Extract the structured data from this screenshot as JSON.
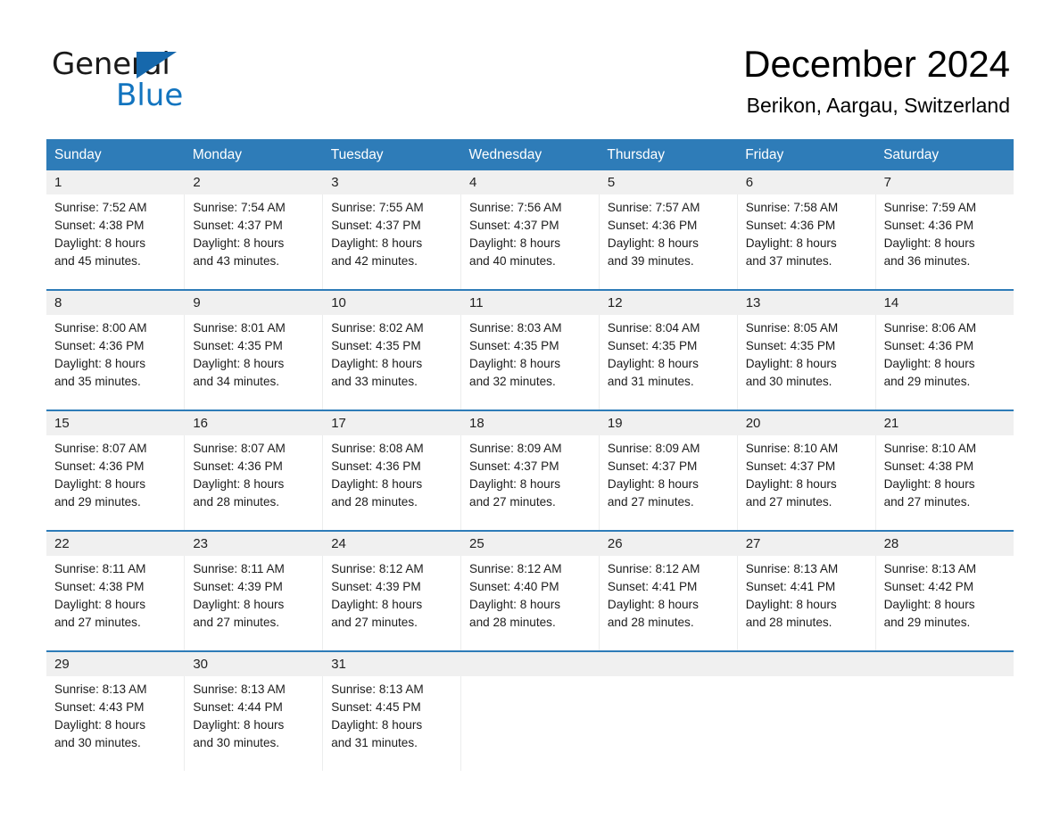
{
  "brand": {
    "word_one": "General",
    "word_two": "Blue",
    "triangle_icon": "triangle-icon",
    "accent_blue": "#1274bf",
    "triangle_color": "#1668ac"
  },
  "header": {
    "title": "December 2024",
    "location": "Berikon, Aargau, Switzerland"
  },
  "colors": {
    "header_row_bg": "#2e7cb8",
    "day_number_bg": "#f0f0f0",
    "divider_blue": "#2e7cb8",
    "text": "#1c1c1c"
  },
  "calendar": {
    "weekdays": [
      "Sunday",
      "Monday",
      "Tuesday",
      "Wednesday",
      "Thursday",
      "Friday",
      "Saturday"
    ],
    "weeks": [
      {
        "days": [
          {
            "num": "1",
            "sunrise": "Sunrise: 7:52 AM",
            "sunset": "Sunset: 4:38 PM",
            "daylight_1": "Daylight: 8 hours",
            "daylight_2": "and 45 minutes."
          },
          {
            "num": "2",
            "sunrise": "Sunrise: 7:54 AM",
            "sunset": "Sunset: 4:37 PM",
            "daylight_1": "Daylight: 8 hours",
            "daylight_2": "and 43 minutes."
          },
          {
            "num": "3",
            "sunrise": "Sunrise: 7:55 AM",
            "sunset": "Sunset: 4:37 PM",
            "daylight_1": "Daylight: 8 hours",
            "daylight_2": "and 42 minutes."
          },
          {
            "num": "4",
            "sunrise": "Sunrise: 7:56 AM",
            "sunset": "Sunset: 4:37 PM",
            "daylight_1": "Daylight: 8 hours",
            "daylight_2": "and 40 minutes."
          },
          {
            "num": "5",
            "sunrise": "Sunrise: 7:57 AM",
            "sunset": "Sunset: 4:36 PM",
            "daylight_1": "Daylight: 8 hours",
            "daylight_2": "and 39 minutes."
          },
          {
            "num": "6",
            "sunrise": "Sunrise: 7:58 AM",
            "sunset": "Sunset: 4:36 PM",
            "daylight_1": "Daylight: 8 hours",
            "daylight_2": "and 37 minutes."
          },
          {
            "num": "7",
            "sunrise": "Sunrise: 7:59 AM",
            "sunset": "Sunset: 4:36 PM",
            "daylight_1": "Daylight: 8 hours",
            "daylight_2": "and 36 minutes."
          }
        ]
      },
      {
        "days": [
          {
            "num": "8",
            "sunrise": "Sunrise: 8:00 AM",
            "sunset": "Sunset: 4:36 PM",
            "daylight_1": "Daylight: 8 hours",
            "daylight_2": "and 35 minutes."
          },
          {
            "num": "9",
            "sunrise": "Sunrise: 8:01 AM",
            "sunset": "Sunset: 4:35 PM",
            "daylight_1": "Daylight: 8 hours",
            "daylight_2": "and 34 minutes."
          },
          {
            "num": "10",
            "sunrise": "Sunrise: 8:02 AM",
            "sunset": "Sunset: 4:35 PM",
            "daylight_1": "Daylight: 8 hours",
            "daylight_2": "and 33 minutes."
          },
          {
            "num": "11",
            "sunrise": "Sunrise: 8:03 AM",
            "sunset": "Sunset: 4:35 PM",
            "daylight_1": "Daylight: 8 hours",
            "daylight_2": "and 32 minutes."
          },
          {
            "num": "12",
            "sunrise": "Sunrise: 8:04 AM",
            "sunset": "Sunset: 4:35 PM",
            "daylight_1": "Daylight: 8 hours",
            "daylight_2": "and 31 minutes."
          },
          {
            "num": "13",
            "sunrise": "Sunrise: 8:05 AM",
            "sunset": "Sunset: 4:35 PM",
            "daylight_1": "Daylight: 8 hours",
            "daylight_2": "and 30 minutes."
          },
          {
            "num": "14",
            "sunrise": "Sunrise: 8:06 AM",
            "sunset": "Sunset: 4:36 PM",
            "daylight_1": "Daylight: 8 hours",
            "daylight_2": "and 29 minutes."
          }
        ]
      },
      {
        "days": [
          {
            "num": "15",
            "sunrise": "Sunrise: 8:07 AM",
            "sunset": "Sunset: 4:36 PM",
            "daylight_1": "Daylight: 8 hours",
            "daylight_2": "and 29 minutes."
          },
          {
            "num": "16",
            "sunrise": "Sunrise: 8:07 AM",
            "sunset": "Sunset: 4:36 PM",
            "daylight_1": "Daylight: 8 hours",
            "daylight_2": "and 28 minutes."
          },
          {
            "num": "17",
            "sunrise": "Sunrise: 8:08 AM",
            "sunset": "Sunset: 4:36 PM",
            "daylight_1": "Daylight: 8 hours",
            "daylight_2": "and 28 minutes."
          },
          {
            "num": "18",
            "sunrise": "Sunrise: 8:09 AM",
            "sunset": "Sunset: 4:37 PM",
            "daylight_1": "Daylight: 8 hours",
            "daylight_2": "and 27 minutes."
          },
          {
            "num": "19",
            "sunrise": "Sunrise: 8:09 AM",
            "sunset": "Sunset: 4:37 PM",
            "daylight_1": "Daylight: 8 hours",
            "daylight_2": "and 27 minutes."
          },
          {
            "num": "20",
            "sunrise": "Sunrise: 8:10 AM",
            "sunset": "Sunset: 4:37 PM",
            "daylight_1": "Daylight: 8 hours",
            "daylight_2": "and 27 minutes."
          },
          {
            "num": "21",
            "sunrise": "Sunrise: 8:10 AM",
            "sunset": "Sunset: 4:38 PM",
            "daylight_1": "Daylight: 8 hours",
            "daylight_2": "and 27 minutes."
          }
        ]
      },
      {
        "days": [
          {
            "num": "22",
            "sunrise": "Sunrise: 8:11 AM",
            "sunset": "Sunset: 4:38 PM",
            "daylight_1": "Daylight: 8 hours",
            "daylight_2": "and 27 minutes."
          },
          {
            "num": "23",
            "sunrise": "Sunrise: 8:11 AM",
            "sunset": "Sunset: 4:39 PM",
            "daylight_1": "Daylight: 8 hours",
            "daylight_2": "and 27 minutes."
          },
          {
            "num": "24",
            "sunrise": "Sunrise: 8:12 AM",
            "sunset": "Sunset: 4:39 PM",
            "daylight_1": "Daylight: 8 hours",
            "daylight_2": "and 27 minutes."
          },
          {
            "num": "25",
            "sunrise": "Sunrise: 8:12 AM",
            "sunset": "Sunset: 4:40 PM",
            "daylight_1": "Daylight: 8 hours",
            "daylight_2": "and 28 minutes."
          },
          {
            "num": "26",
            "sunrise": "Sunrise: 8:12 AM",
            "sunset": "Sunset: 4:41 PM",
            "daylight_1": "Daylight: 8 hours",
            "daylight_2": "and 28 minutes."
          },
          {
            "num": "27",
            "sunrise": "Sunrise: 8:13 AM",
            "sunset": "Sunset: 4:41 PM",
            "daylight_1": "Daylight: 8 hours",
            "daylight_2": "and 28 minutes."
          },
          {
            "num": "28",
            "sunrise": "Sunrise: 8:13 AM",
            "sunset": "Sunset: 4:42 PM",
            "daylight_1": "Daylight: 8 hours",
            "daylight_2": "and 29 minutes."
          }
        ]
      },
      {
        "days": [
          {
            "num": "29",
            "sunrise": "Sunrise: 8:13 AM",
            "sunset": "Sunset: 4:43 PM",
            "daylight_1": "Daylight: 8 hours",
            "daylight_2": "and 30 minutes."
          },
          {
            "num": "30",
            "sunrise": "Sunrise: 8:13 AM",
            "sunset": "Sunset: 4:44 PM",
            "daylight_1": "Daylight: 8 hours",
            "daylight_2": "and 30 minutes."
          },
          {
            "num": "31",
            "sunrise": "Sunrise: 8:13 AM",
            "sunset": "Sunset: 4:45 PM",
            "daylight_1": "Daylight: 8 hours",
            "daylight_2": "and 31 minutes."
          },
          {
            "num": "",
            "sunrise": "",
            "sunset": "",
            "daylight_1": "",
            "daylight_2": "",
            "empty": true
          },
          {
            "num": "",
            "sunrise": "",
            "sunset": "",
            "daylight_1": "",
            "daylight_2": "",
            "empty": true
          },
          {
            "num": "",
            "sunrise": "",
            "sunset": "",
            "daylight_1": "",
            "daylight_2": "",
            "empty": true
          },
          {
            "num": "",
            "sunrise": "",
            "sunset": "",
            "daylight_1": "",
            "daylight_2": "",
            "empty": true
          }
        ]
      }
    ]
  }
}
